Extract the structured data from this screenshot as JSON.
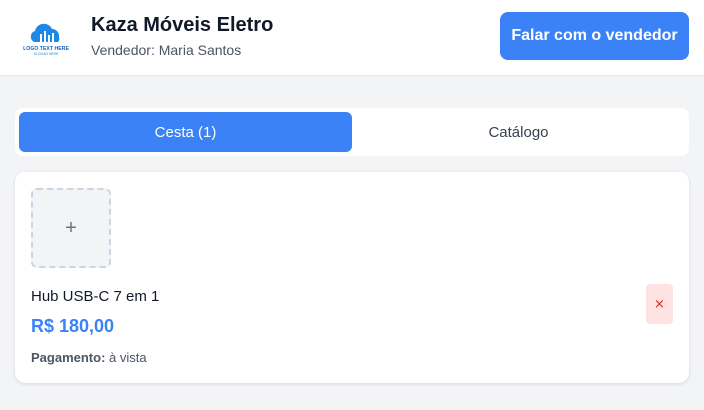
{
  "header": {
    "logo": {
      "text": "LOGO TEXT HERE",
      "slogan": "SLOGAN HERE",
      "color": "#1e88e5"
    },
    "store_name": "Kaza Móveis Eletro",
    "seller_label": "Vendedor:",
    "seller_name": "Maria Santos",
    "contact_button": "Falar com o vendedor"
  },
  "tabs": [
    {
      "label": "Cesta (1)",
      "active": true
    },
    {
      "label": "Catálogo",
      "active": false
    }
  ],
  "cart": {
    "items": [
      {
        "image_placeholder": "+",
        "name": "Hub USB-C 7 em 1",
        "price": "R$ 180,00",
        "payment_label": "Pagamento:",
        "payment_value": "à vista",
        "remove_symbol": "×"
      }
    ]
  },
  "colors": {
    "accent": "#3b82f6",
    "danger_bg": "#fee2e2",
    "danger": "#dc2626"
  }
}
